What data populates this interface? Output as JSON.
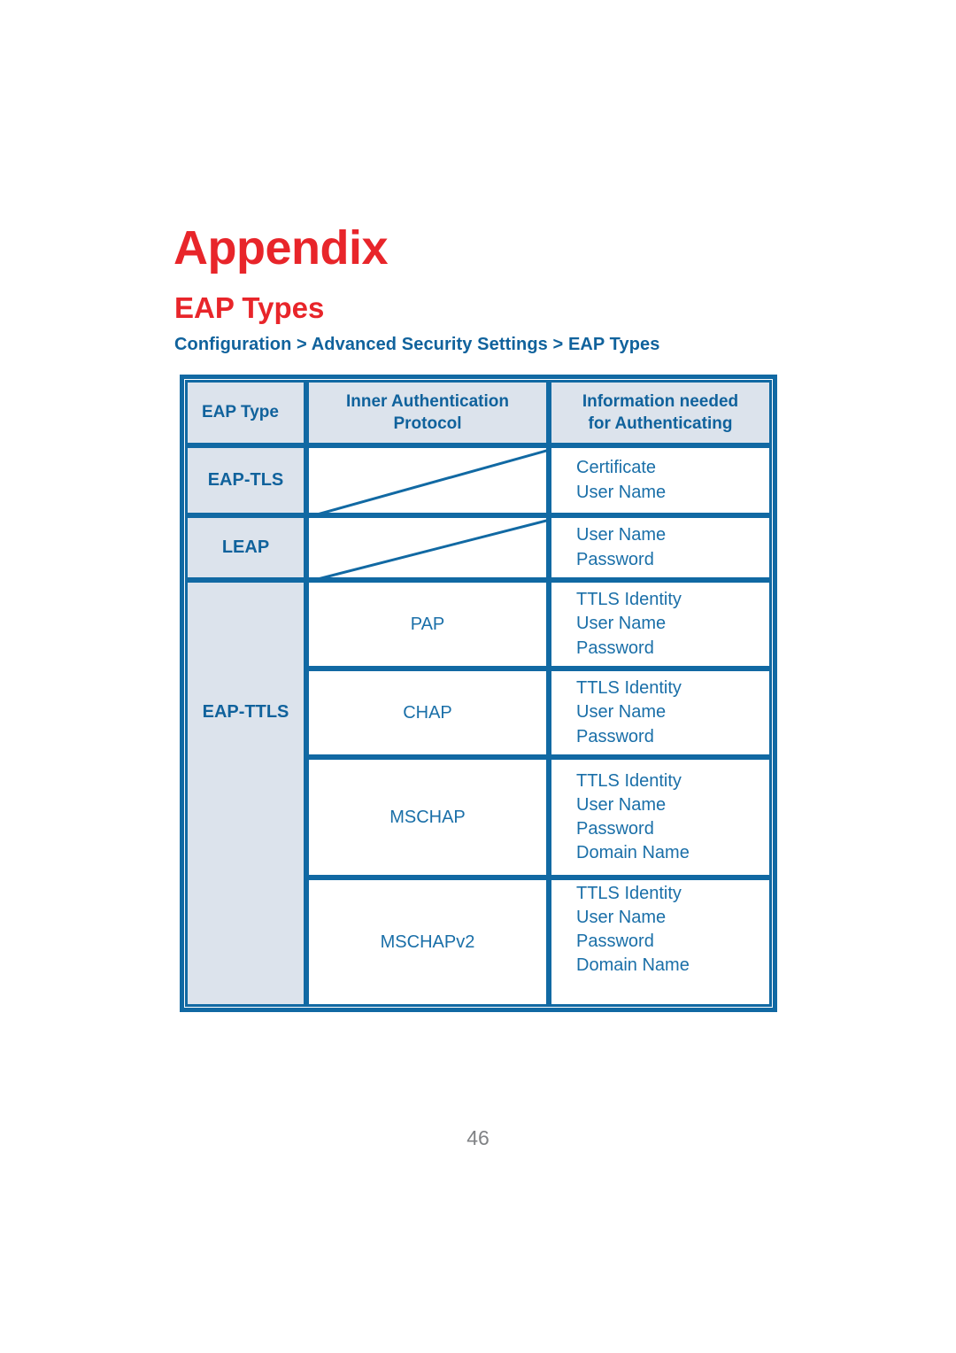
{
  "document": {
    "appendix_title": "Appendix",
    "section_title": "EAP Types",
    "breadcrumb": "Configuration > Advanced Security Settings > EAP Types",
    "page_number": "46"
  },
  "colors": {
    "title_red": "#E8252A",
    "heading_blue": "#10629C",
    "body_blue": "#1A6FA8",
    "border_blue": "#1169A3",
    "header_fill": "#DCE3EC",
    "page_number_gray": "#808285"
  },
  "table": {
    "headers": {
      "eap_type": "EAP Type",
      "inner_protocol_line1": "Inner Authentication",
      "inner_protocol_line2": "Protocol",
      "information_line1": "Information needed",
      "information_line2": "for Authenticating"
    },
    "groups": [
      {
        "eap_type": "EAP-TLS",
        "rows": [
          {
            "protocol": "",
            "protocol_is_diagonal": "true",
            "information": [
              "Certificate",
              "User Name"
            ]
          }
        ]
      },
      {
        "eap_type": "LEAP",
        "rows": [
          {
            "protocol": "",
            "protocol_is_diagonal": "true",
            "information": [
              "User Name",
              "Password"
            ]
          }
        ]
      },
      {
        "eap_type": "EAP-TTLS",
        "rows": [
          {
            "protocol": "PAP",
            "information": [
              "TTLS Identity",
              "User Name",
              "Password"
            ]
          },
          {
            "protocol": "CHAP",
            "information": [
              "TTLS Identity",
              "User Name",
              "Password"
            ]
          },
          {
            "protocol": "MSCHAP",
            "information": [
              "TTLS Identity",
              "User Name",
              "Password",
              "Domain Name"
            ]
          },
          {
            "protocol": "MSCHAPv2",
            "information": [
              "TTLS Identity",
              "User Name",
              "Password",
              "Domain Name"
            ]
          }
        ]
      }
    ]
  }
}
